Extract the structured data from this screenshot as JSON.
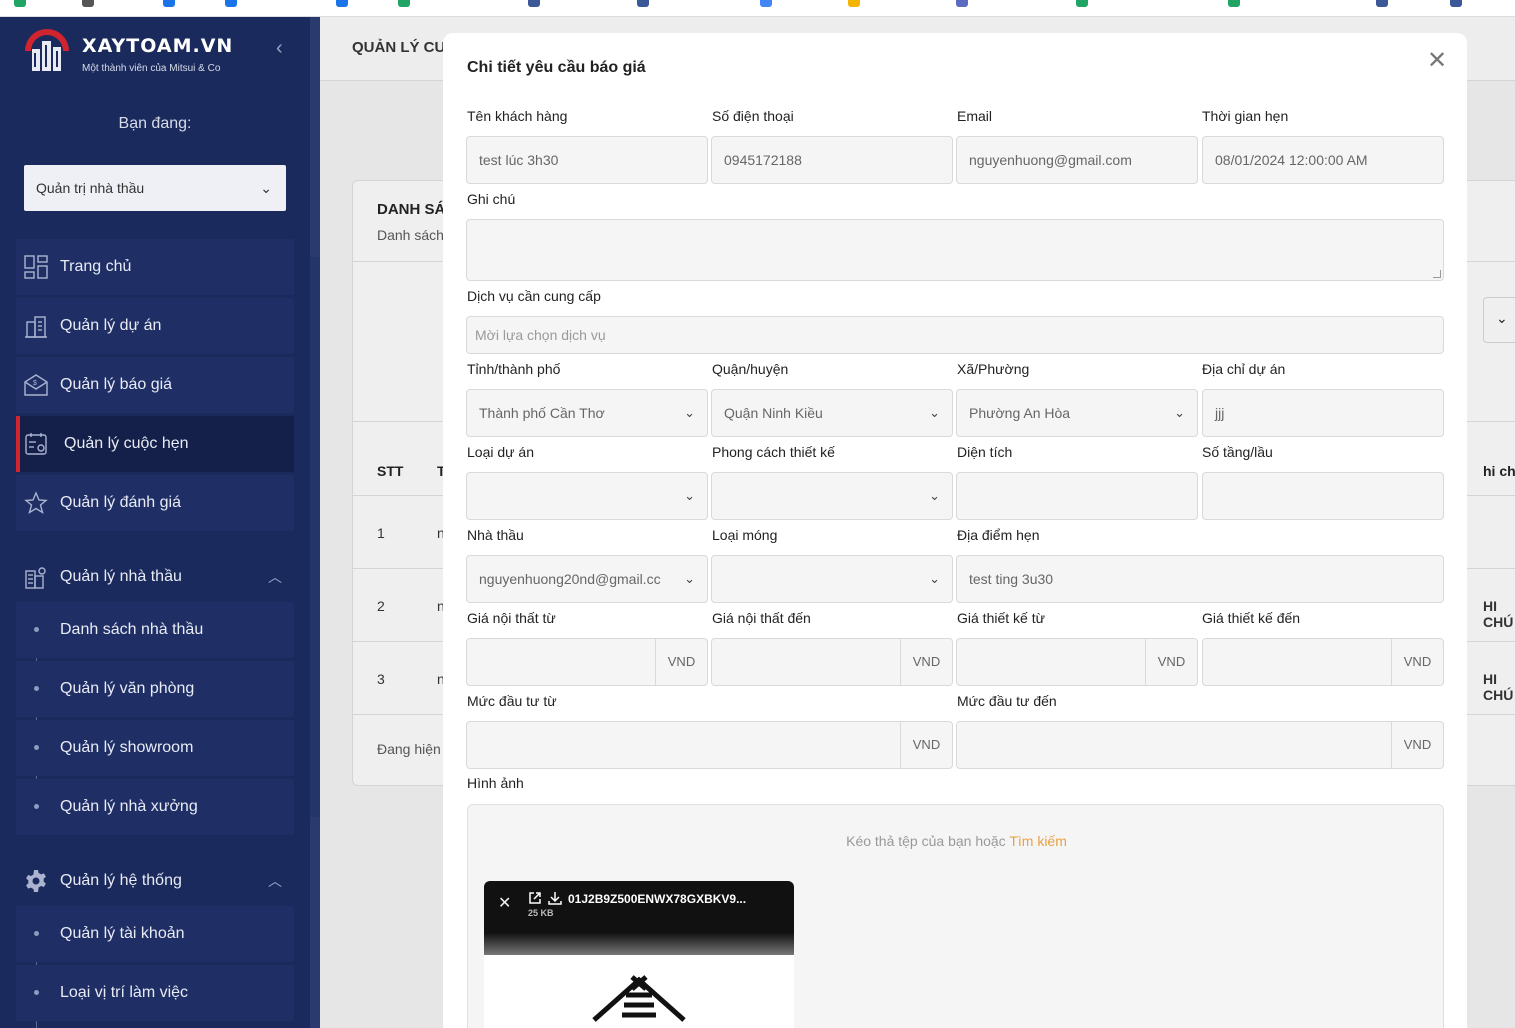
{
  "sidebar": {
    "brand_title": "XAYTOAM.VN",
    "brand_subtitle": "Một thành viên của Mitsui & Co",
    "you_are_label": "Bạn đang:",
    "role": "Quản trị nhà thầu",
    "items": [
      {
        "label": "Trang chủ",
        "icon": "dashboard-icon"
      },
      {
        "label": "Quản lý dự án",
        "icon": "building-icon"
      },
      {
        "label": "Quản lý báo giá",
        "icon": "quote-envelope-icon"
      },
      {
        "label": "Quản lý cuộc hẹn",
        "icon": "appointment-icon",
        "active": true
      },
      {
        "label": "Quản lý đánh giá",
        "icon": "star-icon"
      }
    ],
    "contractor_group": {
      "label": "Quản lý nhà thầu",
      "icon": "contractor-icon",
      "children": [
        "Danh sách nhà thầu",
        "Quản lý văn phòng",
        "Quản lý showroom",
        "Quản lý nhà xưởng"
      ]
    },
    "system_group": {
      "label": "Quản lý hệ thống",
      "icon": "gear-icon",
      "children": [
        "Quản lý tài khoản",
        "Loại vị trí làm việc"
      ]
    }
  },
  "background_page": {
    "header_title": "QUẢN LÝ CU",
    "card_title": "DANH SÁ",
    "card_subtitle": "Danh sách",
    "columns": [
      "STT",
      "T",
      "hi chú"
    ],
    "rows": [
      {
        "stt": "1",
        "name": "n",
        "note": ""
      },
      {
        "stt": "2",
        "name": "n",
        "note": "HI CHÚ"
      },
      {
        "stt": "3",
        "name": "n",
        "note": "HI CHÚ"
      }
    ],
    "pager_text": "Đang hiện"
  },
  "modal": {
    "title": "Chi tiết yêu cầu báo giá",
    "customer_name": {
      "label": "Tên khách hàng",
      "value": "test lúc 3h30"
    },
    "phone": {
      "label": "Số điện thoại",
      "value": "0945172188"
    },
    "email": {
      "label": "Email",
      "value": "nguyenhuong@gmail.com"
    },
    "appointment_time": {
      "label": "Thời gian hẹn",
      "value": "08/01/2024 12:00:00 AM"
    },
    "note": {
      "label": "Ghi chú",
      "value": ""
    },
    "services": {
      "label": "Dịch vụ cần cung cấp",
      "placeholder": "Mời lựa chọn dịch vụ"
    },
    "province": {
      "label": "Tỉnh/thành phố",
      "value": "Thành phố Cần Thơ"
    },
    "district": {
      "label": "Quận/huyện",
      "value": "Quận Ninh Kiều"
    },
    "ward": {
      "label": "Xã/Phường",
      "value": "Phường An Hòa"
    },
    "project_address": {
      "label": "Địa chỉ dự án",
      "value": "jjj"
    },
    "project_type": {
      "label": "Loại dự án",
      "value": ""
    },
    "design_style": {
      "label": "Phong cách thiết kế",
      "value": ""
    },
    "area": {
      "label": "Diện tích",
      "value": ""
    },
    "floors": {
      "label": "Số tầng/lầu",
      "value": ""
    },
    "contractor": {
      "label": "Nhà thầu",
      "value": "nguyenhuong20nd@gmail.cc"
    },
    "foundation_type": {
      "label": "Loại móng",
      "value": ""
    },
    "meeting_place": {
      "label": "Địa điểm hẹn",
      "value": "test ting 3u30"
    },
    "interior_price_from": {
      "label": "Giá nội thất từ",
      "unit": "VND"
    },
    "interior_price_to": {
      "label": "Giá nội thất đến",
      "unit": "VND"
    },
    "design_price_from": {
      "label": "Giá thiết kế từ",
      "unit": "VND"
    },
    "design_price_to": {
      "label": "Giá thiết kế đến",
      "unit": "VND"
    },
    "investment_from": {
      "label": "Mức đầu tư từ",
      "unit": "VND"
    },
    "investment_to": {
      "label": "Mức đầu tư đến",
      "unit": "VND"
    },
    "images": {
      "label": "Hình ảnh",
      "drop_text": "Kéo thả tệp của bạn hoặc",
      "drop_link": "Tìm kiếm",
      "file_name": "01J2B9Z500ENWX78GXBKV9...",
      "file_size": "25 KB"
    }
  },
  "colors": {
    "sidebar_bg": "#1b2a5c",
    "active_accent": "#d0252f",
    "link_orange": "#e8a146"
  }
}
